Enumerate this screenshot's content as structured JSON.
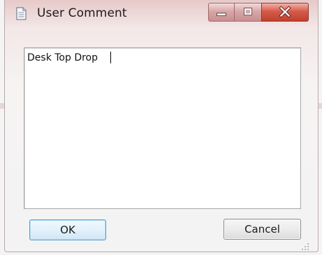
{
  "window": {
    "title": "User Comment",
    "icon": "document-icon",
    "controls": {
      "minimize": "minimize-icon",
      "maximize": "maximize-icon",
      "close": "close-icon"
    }
  },
  "comment": {
    "value": "Desk Top Drop"
  },
  "buttons": {
    "ok_label": "OK",
    "cancel_label": "Cancel"
  },
  "colors": {
    "title_bar": "#e7c9c9",
    "close_button": "#c0402f",
    "ok_button_border": "#4d9fd0"
  }
}
